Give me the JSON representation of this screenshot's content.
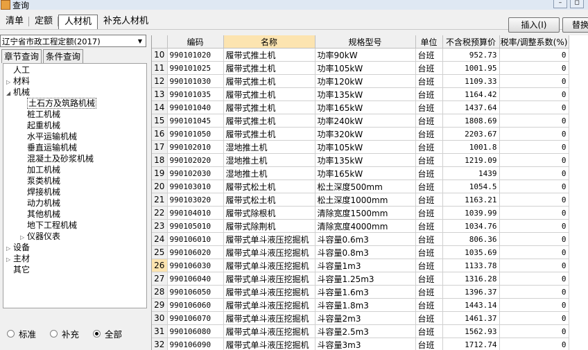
{
  "window": {
    "title": "查询"
  },
  "tabs": [
    "清单",
    "定额",
    "人材机",
    "补充人材机"
  ],
  "buttons": {
    "insert": "插入(I)",
    "replace": "替换"
  },
  "left": {
    "quota_select": "辽宁省市政工程定额(2017)",
    "subtabs": [
      "章节查询",
      "条件查询"
    ],
    "tree": [
      {
        "label": "人工",
        "level": 0,
        "expander": ""
      },
      {
        "label": "材料",
        "level": 0,
        "expander": "▷"
      },
      {
        "label": "机械",
        "level": 0,
        "expander": "◢"
      },
      {
        "label": "土石方及筑路机械",
        "level": 1,
        "expander": "",
        "selected": true
      },
      {
        "label": "桩工机械",
        "level": 1,
        "expander": ""
      },
      {
        "label": "起重机械",
        "level": 1,
        "expander": ""
      },
      {
        "label": "水平运输机械",
        "level": 1,
        "expander": ""
      },
      {
        "label": "垂直运输机械",
        "level": 1,
        "expander": ""
      },
      {
        "label": "混凝土及砂浆机械",
        "level": 1,
        "expander": ""
      },
      {
        "label": "加工机械",
        "level": 1,
        "expander": ""
      },
      {
        "label": "泵类机械",
        "level": 1,
        "expander": ""
      },
      {
        "label": "焊接机械",
        "level": 1,
        "expander": ""
      },
      {
        "label": "动力机械",
        "level": 1,
        "expander": ""
      },
      {
        "label": "其他机械",
        "level": 1,
        "expander": ""
      },
      {
        "label": "地下工程机械",
        "level": 1,
        "expander": ""
      },
      {
        "label": "仪器仪表",
        "level": 1,
        "expander": "▷"
      },
      {
        "label": "设备",
        "level": 0,
        "expander": "▷"
      },
      {
        "label": "主材",
        "level": 0,
        "expander": "▷"
      },
      {
        "label": "其它",
        "level": 0,
        "expander": ""
      }
    ],
    "radios": [
      {
        "label": "标准",
        "checked": false
      },
      {
        "label": "补充",
        "checked": false
      },
      {
        "label": "全部",
        "checked": true
      }
    ]
  },
  "table": {
    "columns": [
      "",
      "编码",
      "名称",
      "规格型号",
      "单位",
      "不含税预算价",
      "税率/调整系数(%)"
    ],
    "rows": [
      [
        "10",
        "990101020",
        "履带式推土机",
        "功率90kW",
        "台班",
        "952.73",
        "0"
      ],
      [
        "11",
        "990101025",
        "履带式推土机",
        "功率105kW",
        "台班",
        "1001.95",
        "0"
      ],
      [
        "12",
        "990101030",
        "履带式推土机",
        "功率120kW",
        "台班",
        "1109.33",
        "0"
      ],
      [
        "13",
        "990101035",
        "履带式推土机",
        "功率135kW",
        "台班",
        "1164.42",
        "0"
      ],
      [
        "14",
        "990101040",
        "履带式推土机",
        "功率165kW",
        "台班",
        "1437.64",
        "0"
      ],
      [
        "15",
        "990101045",
        "履带式推土机",
        "功率240kW",
        "台班",
        "1808.69",
        "0"
      ],
      [
        "16",
        "990101050",
        "履带式推土机",
        "功率320kW",
        "台班",
        "2203.67",
        "0"
      ],
      [
        "17",
        "990102010",
        "湿地推土机",
        "功率105kW",
        "台班",
        "1001.8",
        "0"
      ],
      [
        "18",
        "990102020",
        "湿地推土机",
        "功率135kW",
        "台班",
        "1219.09",
        "0"
      ],
      [
        "19",
        "990102030",
        "湿地推土机",
        "功率165kW",
        "台班",
        "1439",
        "0"
      ],
      [
        "20",
        "990103010",
        "履带式松土机",
        "松土深度500mm",
        "台班",
        "1054.5",
        "0"
      ],
      [
        "21",
        "990103020",
        "履带式松土机",
        "松土深度1000mm",
        "台班",
        "1163.21",
        "0"
      ],
      [
        "22",
        "990104010",
        "履带式除根机",
        "清除宽度1500mm",
        "台班",
        "1039.99",
        "0"
      ],
      [
        "23",
        "990105010",
        "履带式除荆机",
        "清除宽度4000mm",
        "台班",
        "1034.76",
        "0"
      ],
      [
        "24",
        "990106010",
        "履带式单斗液压挖掘机",
        "斗容量0.6m3",
        "台班",
        "806.36",
        "0"
      ],
      [
        "25",
        "990106020",
        "履带式单斗液压挖掘机",
        "斗容量0.8m3",
        "台班",
        "1035.69",
        "0"
      ],
      [
        "26",
        "990106030",
        "履带式单斗液压挖掘机",
        "斗容量1m3",
        "台班",
        "1133.78",
        "0"
      ],
      [
        "27",
        "990106040",
        "履带式单斗液压挖掘机",
        "斗容量1.25m3",
        "台班",
        "1316.28",
        "0"
      ],
      [
        "28",
        "990106050",
        "履带式单斗液压挖掘机",
        "斗容量1.6m3",
        "台班",
        "1396.37",
        "0"
      ],
      [
        "29",
        "990106060",
        "履带式单斗液压挖掘机",
        "斗容量1.8m3",
        "台班",
        "1443.14",
        "0"
      ],
      [
        "30",
        "990106070",
        "履带式单斗液压挖掘机",
        "斗容量2m3",
        "台班",
        "1461.37",
        "0"
      ],
      [
        "31",
        "990106080",
        "履带式单斗液压挖掘机",
        "斗容量2.5m3",
        "台班",
        "1562.93",
        "0"
      ],
      [
        "32",
        "990106090",
        "履带式单斗液压挖掘机",
        "斗容量3m3",
        "台班",
        "1712.74",
        "0"
      ]
    ],
    "current_row": "26"
  }
}
